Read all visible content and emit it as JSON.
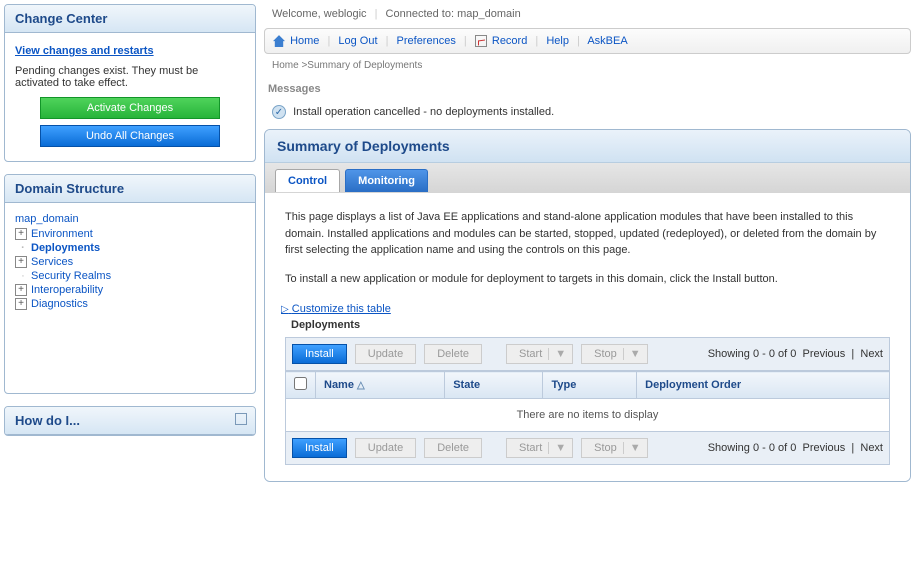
{
  "change_center": {
    "title": "Change Center",
    "view_changes": "View changes and restarts",
    "pending_msg": "Pending changes exist. They must be activated to take effect.",
    "activate": "Activate Changes",
    "undo": "Undo All Changes"
  },
  "domain_structure": {
    "title": "Domain Structure",
    "root": "map_domain",
    "items": [
      {
        "label": "Environment",
        "expandable": true
      },
      {
        "label": "Deployments",
        "expandable": false,
        "active": true
      },
      {
        "label": "Services",
        "expandable": true
      },
      {
        "label": "Security Realms",
        "expandable": false
      },
      {
        "label": "Interoperability",
        "expandable": true
      },
      {
        "label": "Diagnostics",
        "expandable": true
      }
    ]
  },
  "howdoi": {
    "title": "How do I..."
  },
  "topbar": {
    "welcome": "Welcome, weblogic",
    "connected": "Connected to: map_domain"
  },
  "toolbar": {
    "home": "Home",
    "logout": "Log Out",
    "preferences": "Preferences",
    "record": "Record",
    "help": "Help",
    "askbea": "AskBEA"
  },
  "breadcrumb": "Home >Summary of Deployments",
  "messages": {
    "heading": "Messages",
    "line": "Install operation cancelled - no deployments installed."
  },
  "main": {
    "title": "Summary of Deployments",
    "tabs": {
      "control": "Control",
      "monitoring": "Monitoring"
    },
    "desc1": "This page displays a list of Java EE applications and stand-alone application modules that have been installed to this domain. Installed applications and modules can be started, stopped, updated (redeployed), or deleted from the domain by first selecting the application name and using the controls on this page.",
    "desc2": "To install a new application or module for deployment to targets in this domain, click the Install button.",
    "customize": "Customize this table",
    "table_label": "Deployments",
    "buttons": {
      "install": "Install",
      "update": "Update",
      "delete": "Delete",
      "start": "Start",
      "stop": "Stop"
    },
    "pager": {
      "showing": "Showing 0 - 0 of 0",
      "prev": "Previous",
      "next": "Next"
    },
    "columns": {
      "name": "Name",
      "state": "State",
      "type": "Type",
      "order": "Deployment Order"
    },
    "empty": "There are no items to display"
  }
}
